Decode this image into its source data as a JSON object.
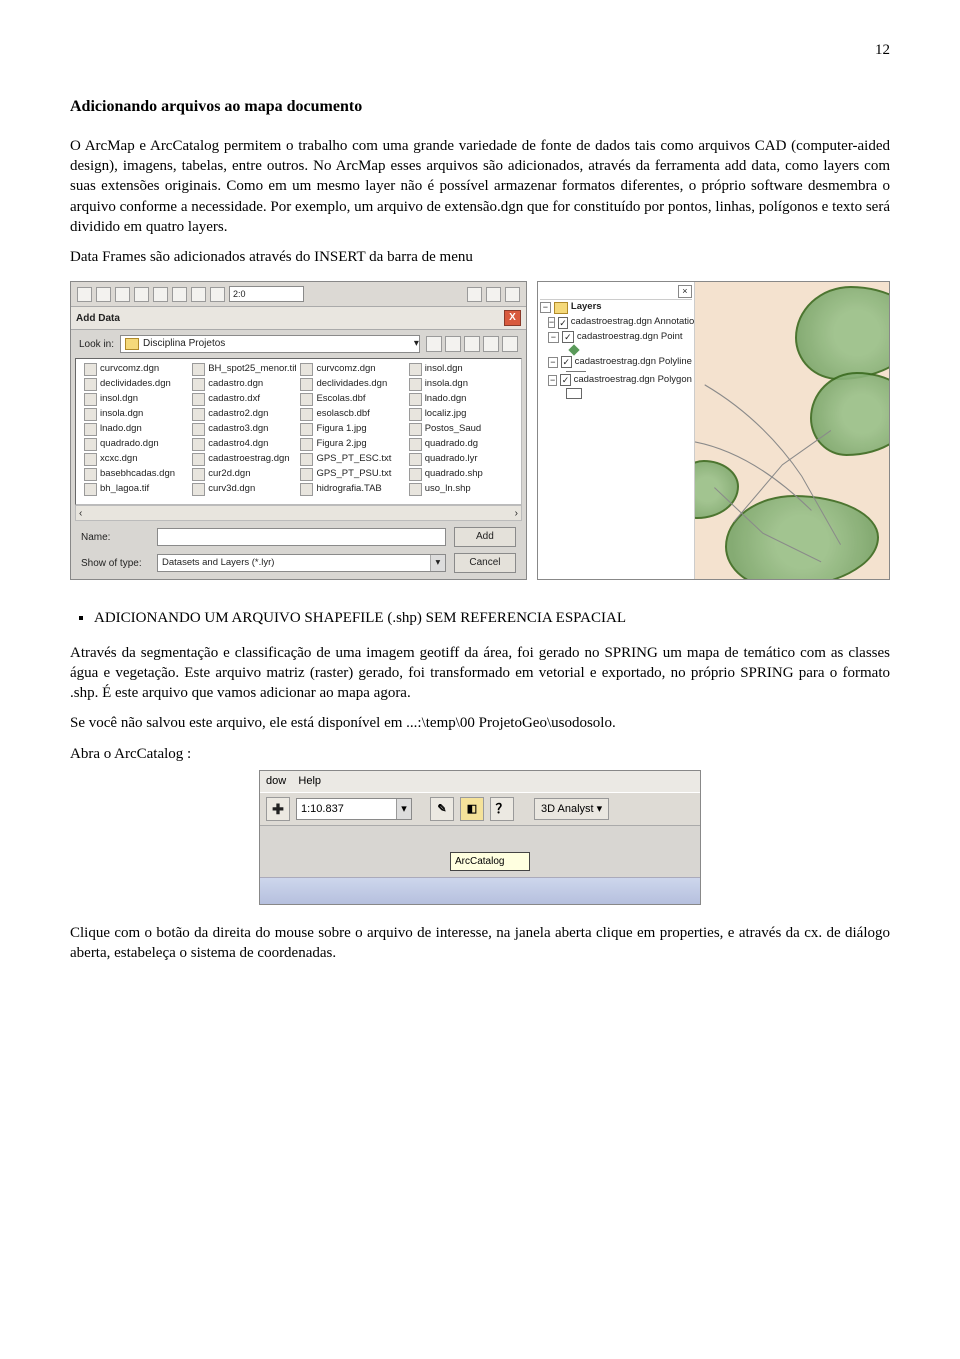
{
  "page_number": "12",
  "heading": "Adicionando arquivos ao mapa documento",
  "para1": "O ArcMap e ArcCatalog permitem o trabalho com uma grande variedade de fonte de dados tais como arquivos CAD (computer-aided design), imagens, tabelas, entre outros. No ArcMap esses arquivos são adicionados, através da ferramenta add data, como layers com suas extensões originais. Como em um mesmo layer não é possível armazenar formatos diferentes, o próprio software desmembra o arquivo conforme a necessidade. Por exemplo, um arquivo de extensão.dgn que for constituído por pontos, linhas, polígonos e texto será dividido em quatro layers.",
  "para2": "Data Frames são adicionados através do INSERT da barra de menu",
  "add_data": {
    "title": "Add Data",
    "close": "X",
    "lookin_label": "Look in:",
    "lookin_value": "Disciplina Projetos",
    "files_col1": [
      "curvcomz.dgn",
      "declividades.dgn",
      "insol.dgn",
      "insola.dgn",
      "lnado.dgn",
      "quadrado.dgn",
      "xcxc.dgn",
      "basebhcadas.dgn",
      "bh_lagoa.tif"
    ],
    "files_col2": [
      "BH_spot25_menor.tif",
      "cadastro.dgn",
      "cadastro.dxf",
      "cadastro2.dgn",
      "cadastro3.dgn",
      "cadastro4.dgn",
      "cadastroestrag.dgn",
      "cur2d.dgn",
      "curv3d.dgn"
    ],
    "files_col3": [
      "curvcomz.dgn",
      "declividades.dgn",
      "Escolas.dbf",
      "esolascb.dbf",
      "Figura 1.jpg",
      "Figura 2.jpg",
      "GPS_PT_ESC.txt",
      "GPS_PT_PSU.txt",
      "hidrografia.TAB"
    ],
    "files_col4": [
      "insol.dgn",
      "insola.dgn",
      "lnado.dgn",
      "localiz.jpg",
      "Postos_Saud",
      "quadrado.dg",
      "quadrado.lyr",
      "quadrado.shp",
      "uso_ln.shp"
    ],
    "name_label": "Name:",
    "type_label": "Show of type:",
    "type_value": "Datasets and Layers (*.lyr)",
    "add_btn": "Add",
    "cancel_btn": "Cancel"
  },
  "toolbar_scale": "2:0",
  "toc": {
    "root": "Layers",
    "layer1": "cadastroestrag.dgn Annotation",
    "layer2": "cadastroestrag.dgn Point",
    "layer3": "cadastroestrag.dgn Polyline",
    "layer4": "cadastroestrag.dgn Polygon",
    "check": "✓"
  },
  "bullet_heading": "ADICIONANDO UM ARQUIVO SHAPEFILE (.shp) SEM REFERENCIA ESPACIAL",
  "para3": "Através da segmentação e classificação de uma imagem geotiff da área, foi gerado no SPRING um mapa de temático com as classes água e vegetação. Este arquivo matriz (raster) gerado, foi transformado em vetorial e exportado, no próprio SPRING para o formato .shp. É este arquivo que vamos adicionar ao mapa agora.",
  "para4": "Se você não salvou este arquivo, ele está disponível em ...:\\temp\\00 ProjetoGeo\\usodosolo.",
  "para5": "Abra o ArcCatalog :",
  "bottom": {
    "menu_dow": "dow",
    "menu_help": "Help",
    "plus": "✚",
    "scale": "1:10.837",
    "analyst": "3D Analyst ▾",
    "tooltip": "ArcCatalog",
    "arrow_icon": "▾"
  },
  "para6": "Clique com o botão da direita do mouse sobre o arquivo de interesse, na janela aberta clique em properties, e através da cx. de diálogo aberta, estabeleça o sistema de coordenadas."
}
